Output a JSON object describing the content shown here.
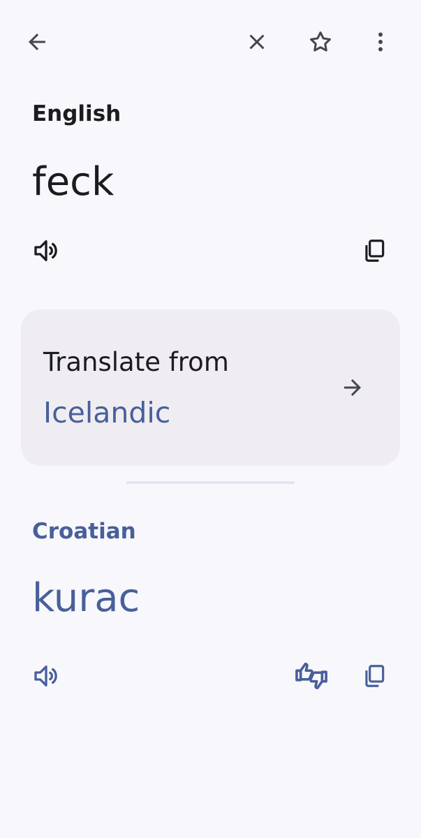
{
  "toolbar": {
    "back_icon": "arrow-left-icon",
    "clear_icon": "close-icon",
    "save_icon": "star-outline-icon",
    "menu_icon": "more-vert-icon"
  },
  "source": {
    "language": "English",
    "text": "feck",
    "listen_icon": "speaker-icon",
    "copy_icon": "copy-icon"
  },
  "detect_card": {
    "title": "Translate from",
    "language": "Icelandic",
    "arrow_icon": "arrow-right-icon"
  },
  "target": {
    "language": "Croatian",
    "text": "kurac",
    "listen_icon": "speaker-icon",
    "feedback_icon": "thumbs-up-down-icon",
    "copy_icon": "copy-icon"
  },
  "colors": {
    "background": "#f8f8fc",
    "card": "#efedf2",
    "accent": "#48609a",
    "text": "#1c1b1f",
    "divider": "#dfe4f5"
  }
}
